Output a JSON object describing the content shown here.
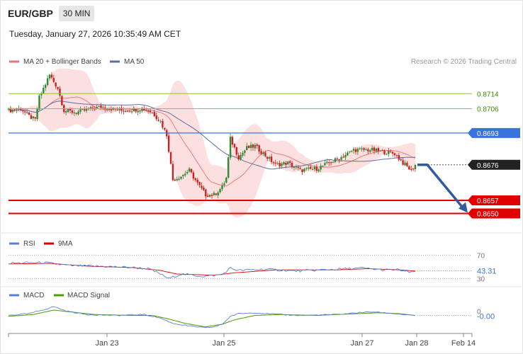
{
  "header": {
    "symbol": "EUR/GBP",
    "timeframe": "30 MIN",
    "datetime": "Tuesday, January 27, 2026 10:35:49 AM CET",
    "copyright": "Research © 2026 Trading Central"
  },
  "colors": {
    "bollinger_band_fill": "#fbd9d9",
    "ma20": "#f07070",
    "ma50": "#5b6fa8",
    "candle_up": "#2f8a2f",
    "candle_down": "#cc2020",
    "resistance": "#8cc63f",
    "pivot": "#3a73e0",
    "support": "#e00000",
    "forecast_arrow": "#2e5c9e",
    "rsi": "#5b7fd6",
    "rsi_9ma": "#e00000",
    "macd": "#5b7fd6",
    "macd_signal": "#4a9c00"
  },
  "chart_data": [
    {
      "type": "candlestick",
      "panel": "price",
      "legend": [
        "MA 20 + Bollinger Bands",
        "MA 50"
      ],
      "legend_placement": "top-left",
      "ylim": [
        8640,
        8730
      ],
      "y_scale_note": "price values stored in pips (×10000)",
      "x_tick_labels": [
        "Jan 23",
        "Jan 25",
        "Jan 27",
        "Jan 28",
        "Feb 14"
      ],
      "levels": [
        {
          "label": "0.8714",
          "value": 0.8714,
          "kind": "resistance"
        },
        {
          "label": "0.8706",
          "value": 0.8706,
          "kind": "resistance"
        },
        {
          "label": "0.8693",
          "value": 0.8693,
          "kind": "pivot"
        },
        {
          "label": "0.8676",
          "value": 0.8676,
          "kind": "last-price"
        },
        {
          "label": "0.8657",
          "value": 0.8657,
          "kind": "support"
        },
        {
          "label": "0.8650",
          "value": 0.865,
          "kind": "support"
        }
      ],
      "forecast": {
        "direction": "down",
        "from": 0.8676,
        "to": 0.865
      },
      "close_anchors": [
        [
          0,
          8705
        ],
        [
          6,
          8706
        ],
        [
          10,
          8702
        ],
        [
          13,
          8700
        ],
        [
          15,
          8712
        ],
        [
          20,
          8724
        ],
        [
          24,
          8717
        ],
        [
          27,
          8705
        ],
        [
          33,
          8704
        ],
        [
          45,
          8707
        ],
        [
          55,
          8705
        ],
        [
          65,
          8706
        ],
        [
          70,
          8704
        ],
        [
          74,
          8699
        ],
        [
          77,
          8692
        ],
        [
          80,
          8668
        ],
        [
          84,
          8670
        ],
        [
          88,
          8673
        ],
        [
          92,
          8666
        ],
        [
          96,
          8660
        ],
        [
          100,
          8660
        ],
        [
          104,
          8664
        ],
        [
          106,
          8669
        ],
        [
          108,
          8690
        ],
        [
          112,
          8680
        ],
        [
          116,
          8685
        ],
        [
          120,
          8686
        ],
        [
          126,
          8680
        ],
        [
          130,
          8676
        ],
        [
          136,
          8677
        ],
        [
          142,
          8673
        ],
        [
          150,
          8674
        ],
        [
          156,
          8677
        ],
        [
          162,
          8680
        ],
        [
          168,
          8684
        ],
        [
          176,
          8684
        ],
        [
          182,
          8683
        ],
        [
          188,
          8682
        ],
        [
          192,
          8677
        ],
        [
          196,
          8673
        ],
        [
          198,
          8676
        ]
      ]
    },
    {
      "type": "line",
      "panel": "rsi",
      "legend": [
        "RSI",
        "9MA"
      ],
      "y_tick_labels": [
        "70",
        "30"
      ],
      "last_value_label": "43.31",
      "ylim": [
        20,
        80
      ],
      "anchors": [
        [
          0,
          56
        ],
        [
          8,
          57
        ],
        [
          18,
          57
        ],
        [
          30,
          52
        ],
        [
          45,
          51
        ],
        [
          60,
          49
        ],
        [
          68,
          47
        ],
        [
          74,
          38
        ],
        [
          78,
          30
        ],
        [
          84,
          38
        ],
        [
          95,
          34
        ],
        [
          104,
          37
        ],
        [
          108,
          48
        ],
        [
          112,
          44
        ],
        [
          125,
          46
        ],
        [
          140,
          43
        ],
        [
          160,
          46
        ],
        [
          172,
          48
        ],
        [
          182,
          45
        ],
        [
          190,
          45
        ],
        [
          196,
          40
        ],
        [
          198,
          43
        ]
      ],
      "ma_anchors": [
        [
          0,
          55
        ],
        [
          20,
          56
        ],
        [
          40,
          51
        ],
        [
          60,
          49
        ],
        [
          74,
          44
        ],
        [
          82,
          38
        ],
        [
          100,
          36
        ],
        [
          110,
          40
        ],
        [
          130,
          45
        ],
        [
          160,
          45
        ],
        [
          175,
          47
        ],
        [
          190,
          45
        ],
        [
          198,
          43
        ]
      ]
    },
    {
      "type": "line",
      "panel": "macd",
      "legend": [
        "MACD",
        "MACD Signal"
      ],
      "y_tick_labels": [
        "0"
      ],
      "last_value_label": "-0.00",
      "ylim": [
        -18,
        14
      ],
      "macd_anchors": [
        [
          0,
          0
        ],
        [
          10,
          2
        ],
        [
          18,
          7
        ],
        [
          22,
          10
        ],
        [
          28,
          5
        ],
        [
          38,
          1
        ],
        [
          52,
          0
        ],
        [
          66,
          1
        ],
        [
          74,
          -3
        ],
        [
          80,
          -9
        ],
        [
          88,
          -12
        ],
        [
          96,
          -14
        ],
        [
          100,
          -13
        ],
        [
          104,
          -10
        ],
        [
          108,
          -1
        ],
        [
          112,
          2
        ],
        [
          120,
          3
        ],
        [
          132,
          1
        ],
        [
          142,
          0
        ],
        [
          160,
          1
        ],
        [
          170,
          3
        ],
        [
          178,
          4
        ],
        [
          188,
          2
        ],
        [
          196,
          0
        ],
        [
          198,
          0
        ]
      ],
      "signal_anchors": [
        [
          0,
          -1
        ],
        [
          12,
          1
        ],
        [
          22,
          6
        ],
        [
          30,
          4
        ],
        [
          42,
          1
        ],
        [
          60,
          0
        ],
        [
          70,
          0
        ],
        [
          78,
          -4
        ],
        [
          86,
          -9
        ],
        [
          96,
          -13
        ],
        [
          104,
          -10
        ],
        [
          110,
          -5
        ],
        [
          120,
          0
        ],
        [
          132,
          1
        ],
        [
          150,
          0
        ],
        [
          170,
          2
        ],
        [
          180,
          3
        ],
        [
          190,
          2
        ],
        [
          198,
          0
        ]
      ]
    }
  ]
}
